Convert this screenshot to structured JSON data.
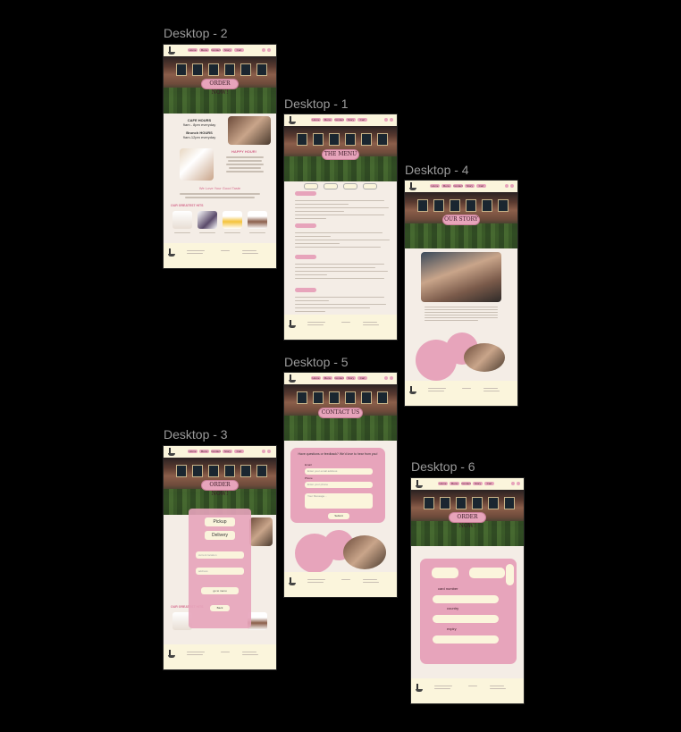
{
  "frames": {
    "d2": {
      "label": "Desktop - 2",
      "hero_button": "ORDER NOW!",
      "cafe_hours": "CAFE HOURS",
      "hours1": "9am - 8pm everyday",
      "brunch": "Brunch HOURS",
      "hours2": "9am-12pm everyday",
      "happy": "HAPPY HOUR!",
      "loved": "We Love Your Good Taste",
      "greatest": "OUR GREATEST HITS"
    },
    "d1": {
      "label": "Desktop - 1",
      "hero_button": "THE MENU"
    },
    "d4": {
      "label": "Desktop - 4",
      "hero_button": "OUR STORY"
    },
    "d5": {
      "label": "Desktop - 5",
      "hero_button": "CONTACT US",
      "form_title": "Have questions or feedback? We'd love to hear from you!",
      "email_label": "Email",
      "email_ph": "Enter your email address",
      "phone_label": "Phone",
      "phone_ph": "Enter your phone",
      "message_ph": "Your Message...",
      "submit": "Submit"
    },
    "d3": {
      "label": "Desktop - 3",
      "hero_button": "ORDER NOW!",
      "pickup": "Pickup",
      "delivery": "Delivery",
      "current_location": "current location",
      "address": "address",
      "go_to_menu": "go to menu",
      "back": "Back"
    },
    "d6": {
      "label": "Desktop - 6",
      "hero_button": "ORDER NOW!",
      "card_label": "card number",
      "country_label": "country",
      "expiry_label": "expiry"
    }
  },
  "nav": [
    "Home",
    "Menu",
    "Contact",
    "Story",
    "Cart"
  ],
  "colors": {
    "pink": "#e7a4bb",
    "cream": "#fbf5dc",
    "canvas": "#000000"
  }
}
